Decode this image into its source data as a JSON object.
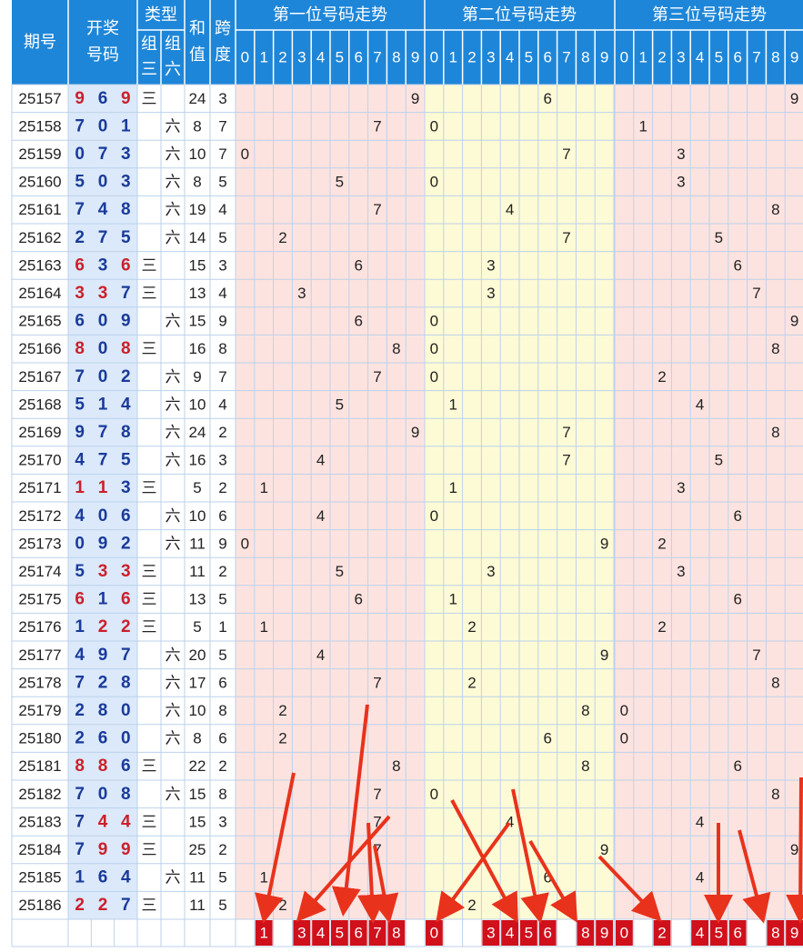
{
  "header": {
    "period": "期号",
    "draw_lines": [
      "开奖",
      "号码"
    ],
    "type": "类型",
    "zu3_lines": [
      "组",
      "三"
    ],
    "zu6_lines": [
      "组",
      "六"
    ],
    "sum_lines": [
      "和",
      "值"
    ],
    "span_lines": [
      "跨",
      "度"
    ],
    "position_titles": [
      "第一位号码走势",
      "第二位号码走势",
      "第三位号码走势"
    ],
    "digits": [
      "0",
      "1",
      "2",
      "3",
      "4",
      "5",
      "6",
      "7",
      "8",
      "9"
    ]
  },
  "type_labels": {
    "zu3": "三",
    "zu6": "六"
  },
  "colors": {
    "header_bg": "#1e86d8",
    "header_text": "#ffffff",
    "draw_bg": "#dbe9fb",
    "zone1_bg": "#fde3e0",
    "zone2_bg": "#fdfbd6",
    "zone3_bg": "#fde3e0",
    "digit_blue": "#1a3a9a",
    "digit_red": "#cc1f2a",
    "pick_bg": "#d0101b",
    "arrow": "#e8321c",
    "grid_line": "#bcd2ea"
  },
  "chart_data": {
    "type": "table",
    "columns": [
      "期号",
      "开奖号码",
      "组三",
      "组六",
      "和值",
      "跨度",
      "第一位号码走势",
      "第二位号码走势",
      "第三位号码走势"
    ],
    "rows": [
      {
        "period": "25157",
        "draw": [
          9,
          6,
          9
        ],
        "type": "三",
        "sum": 24,
        "span": 3
      },
      {
        "period": "25158",
        "draw": [
          7,
          0,
          1
        ],
        "type": "六",
        "sum": 8,
        "span": 7
      },
      {
        "period": "25159",
        "draw": [
          0,
          7,
          3
        ],
        "type": "六",
        "sum": 10,
        "span": 7
      },
      {
        "period": "25160",
        "draw": [
          5,
          0,
          3
        ],
        "type": "六",
        "sum": 8,
        "span": 5
      },
      {
        "period": "25161",
        "draw": [
          7,
          4,
          8
        ],
        "type": "六",
        "sum": 19,
        "span": 4
      },
      {
        "period": "25162",
        "draw": [
          2,
          7,
          5
        ],
        "type": "六",
        "sum": 14,
        "span": 5
      },
      {
        "period": "25163",
        "draw": [
          6,
          3,
          6
        ],
        "type": "三",
        "sum": 15,
        "span": 3
      },
      {
        "period": "25164",
        "draw": [
          3,
          3,
          7
        ],
        "type": "三",
        "sum": 13,
        "span": 4
      },
      {
        "period": "25165",
        "draw": [
          6,
          0,
          9
        ],
        "type": "六",
        "sum": 15,
        "span": 9
      },
      {
        "period": "25166",
        "draw": [
          8,
          0,
          8
        ],
        "type": "三",
        "sum": 16,
        "span": 8
      },
      {
        "period": "25167",
        "draw": [
          7,
          0,
          2
        ],
        "type": "六",
        "sum": 9,
        "span": 7
      },
      {
        "period": "25168",
        "draw": [
          5,
          1,
          4
        ],
        "type": "六",
        "sum": 10,
        "span": 4
      },
      {
        "period": "25169",
        "draw": [
          9,
          7,
          8
        ],
        "type": "六",
        "sum": 24,
        "span": 2
      },
      {
        "period": "25170",
        "draw": [
          4,
          7,
          5
        ],
        "type": "六",
        "sum": 16,
        "span": 3
      },
      {
        "period": "25171",
        "draw": [
          1,
          1,
          3
        ],
        "type": "三",
        "sum": 5,
        "span": 2
      },
      {
        "period": "25172",
        "draw": [
          4,
          0,
          6
        ],
        "type": "六",
        "sum": 10,
        "span": 6
      },
      {
        "period": "25173",
        "draw": [
          0,
          9,
          2
        ],
        "type": "六",
        "sum": 11,
        "span": 9
      },
      {
        "period": "25174",
        "draw": [
          5,
          3,
          3
        ],
        "type": "三",
        "sum": 11,
        "span": 2
      },
      {
        "period": "25175",
        "draw": [
          6,
          1,
          6
        ],
        "type": "三",
        "sum": 13,
        "span": 5
      },
      {
        "period": "25176",
        "draw": [
          1,
          2,
          2
        ],
        "type": "三",
        "sum": 5,
        "span": 1
      },
      {
        "period": "25177",
        "draw": [
          4,
          9,
          7
        ],
        "type": "六",
        "sum": 20,
        "span": 5
      },
      {
        "period": "25178",
        "draw": [
          7,
          2,
          8
        ],
        "type": "六",
        "sum": 17,
        "span": 6
      },
      {
        "period": "25179",
        "draw": [
          2,
          8,
          0
        ],
        "type": "六",
        "sum": 10,
        "span": 8
      },
      {
        "period": "25180",
        "draw": [
          2,
          6,
          0
        ],
        "type": "六",
        "sum": 8,
        "span": 6
      },
      {
        "period": "25181",
        "draw": [
          8,
          8,
          6
        ],
        "type": "三",
        "sum": 22,
        "span": 2
      },
      {
        "period": "25182",
        "draw": [
          7,
          0,
          8
        ],
        "type": "六",
        "sum": 15,
        "span": 8
      },
      {
        "period": "25183",
        "draw": [
          7,
          4,
          4
        ],
        "type": "三",
        "sum": 15,
        "span": 3
      },
      {
        "period": "25184",
        "draw": [
          7,
          9,
          9
        ],
        "type": "三",
        "sum": 25,
        "span": 2
      },
      {
        "period": "25185",
        "draw": [
          1,
          6,
          4
        ],
        "type": "六",
        "sum": 11,
        "span": 5
      },
      {
        "period": "25186",
        "draw": [
          2,
          2,
          7
        ],
        "type": "三",
        "sum": 11,
        "span": 5
      }
    ],
    "picks": [
      [
        1,
        3,
        4,
        5,
        6,
        7,
        8
      ],
      [
        0,
        3,
        4,
        5,
        6,
        8,
        9
      ],
      [
        0,
        2,
        4,
        5,
        6,
        8,
        9
      ]
    ],
    "annotation": "red arrows pointing down to the selected digit cells"
  }
}
